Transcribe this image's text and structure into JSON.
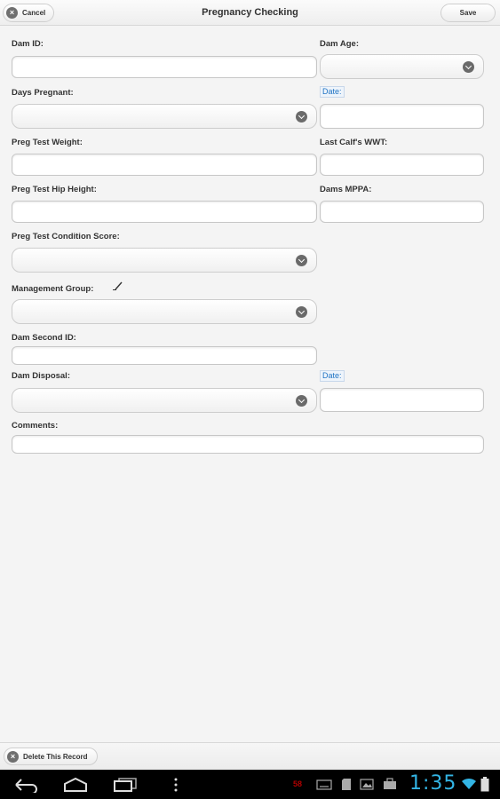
{
  "header": {
    "title": "Pregnancy Checking",
    "cancel_label": "Cancel",
    "save_label": "Save"
  },
  "form": {
    "dam_id": {
      "label": "Dam ID:",
      "value": ""
    },
    "dam_age": {
      "label": "Dam Age:",
      "value": ""
    },
    "days_pregnant": {
      "label": "Days Pregnant:",
      "value": ""
    },
    "date1": {
      "label": "Date:",
      "value": ""
    },
    "preg_test_weight": {
      "label": "Preg Test Weight:",
      "value": ""
    },
    "last_calf_wwt": {
      "label": "Last Calf's WWT:",
      "value": ""
    },
    "preg_test_hip_height": {
      "label": "Preg Test Hip Height:",
      "value": ""
    },
    "dams_mppa": {
      "label": "Dams MPPA:",
      "value": ""
    },
    "preg_test_condition_score": {
      "label": "Preg Test Condition Score:",
      "value": ""
    },
    "management_group": {
      "label": "Management Group:",
      "value": ""
    },
    "dam_second_id": {
      "label": "Dam Second ID:",
      "value": ""
    },
    "dam_disposal": {
      "label": "Dam Disposal:",
      "value": ""
    },
    "date2": {
      "label": "Date:",
      "value": ""
    },
    "comments": {
      "label": "Comments:",
      "value": ""
    }
  },
  "footer": {
    "delete_label": "Delete This Record"
  },
  "status_bar": {
    "time": "1:35",
    "notification_badge": "58"
  },
  "colors": {
    "accent": "#33b5e5",
    "date_label": "#1f73c4"
  }
}
